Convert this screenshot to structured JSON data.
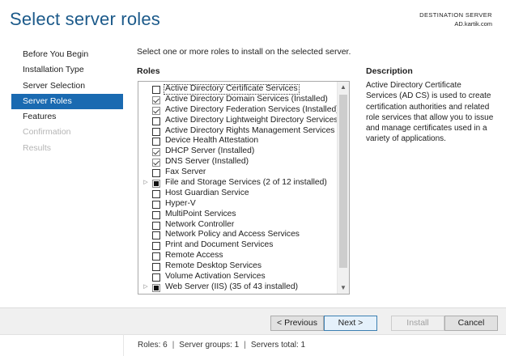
{
  "header": {
    "title": "Select server roles",
    "destination_label": "DESTINATION SERVER",
    "destination_server": "AD.kartik.com"
  },
  "nav": [
    {
      "label": "Before You Begin",
      "state": "normal"
    },
    {
      "label": "Installation Type",
      "state": "normal"
    },
    {
      "label": "Server Selection",
      "state": "normal"
    },
    {
      "label": "Server Roles",
      "state": "active"
    },
    {
      "label": "Features",
      "state": "normal"
    },
    {
      "label": "Confirmation",
      "state": "disabled"
    },
    {
      "label": "Results",
      "state": "disabled"
    }
  ],
  "main": {
    "intro": "Select one or more roles to install on the selected server.",
    "roles_heading": "Roles",
    "description_heading": "Description",
    "description_text": "Active Directory Certificate Services (AD CS) is used to create certification authorities and related role services that allow you to issue and manage certificates used in a variety of applications."
  },
  "roles": [
    {
      "label": "Active Directory Certificate Services",
      "state": "unchecked",
      "expandable": false,
      "selected": true
    },
    {
      "label": "Active Directory Domain Services (Installed)",
      "state": "checked",
      "expandable": false
    },
    {
      "label": "Active Directory Federation Services (Installed)",
      "state": "checked",
      "expandable": false
    },
    {
      "label": "Active Directory Lightweight Directory Services",
      "state": "unchecked",
      "expandable": false
    },
    {
      "label": "Active Directory Rights Management Services",
      "state": "unchecked",
      "expandable": false
    },
    {
      "label": "Device Health Attestation",
      "state": "unchecked",
      "expandable": false
    },
    {
      "label": "DHCP Server (Installed)",
      "state": "checked",
      "expandable": false
    },
    {
      "label": "DNS Server (Installed)",
      "state": "checked",
      "expandable": false
    },
    {
      "label": "Fax Server",
      "state": "unchecked",
      "expandable": false
    },
    {
      "label": "File and Storage Services (2 of 12 installed)",
      "state": "partial",
      "expandable": true
    },
    {
      "label": "Host Guardian Service",
      "state": "unchecked",
      "expandable": false
    },
    {
      "label": "Hyper-V",
      "state": "unchecked",
      "expandable": false
    },
    {
      "label": "MultiPoint Services",
      "state": "unchecked",
      "expandable": false
    },
    {
      "label": "Network Controller",
      "state": "unchecked",
      "expandable": false
    },
    {
      "label": "Network Policy and Access Services",
      "state": "unchecked",
      "expandable": false
    },
    {
      "label": "Print and Document Services",
      "state": "unchecked",
      "expandable": false
    },
    {
      "label": "Remote Access",
      "state": "unchecked",
      "expandable": false
    },
    {
      "label": "Remote Desktop Services",
      "state": "unchecked",
      "expandable": false
    },
    {
      "label": "Volume Activation Services",
      "state": "unchecked",
      "expandable": false
    },
    {
      "label": "Web Server (IIS) (35 of 43 installed)",
      "state": "partial",
      "expandable": true
    }
  ],
  "buttons": {
    "previous": "< Previous",
    "next": "Next >",
    "install": "Install",
    "cancel": "Cancel"
  },
  "status": {
    "roles": "Roles: 6",
    "server_groups": "Server groups: 1",
    "servers_total": "Servers total: 1",
    "separator": "|"
  },
  "icons": {
    "expander": "triangle-right-icon",
    "scroll_up": "chevron-up-icon",
    "scroll_down": "chevron-down-icon"
  }
}
